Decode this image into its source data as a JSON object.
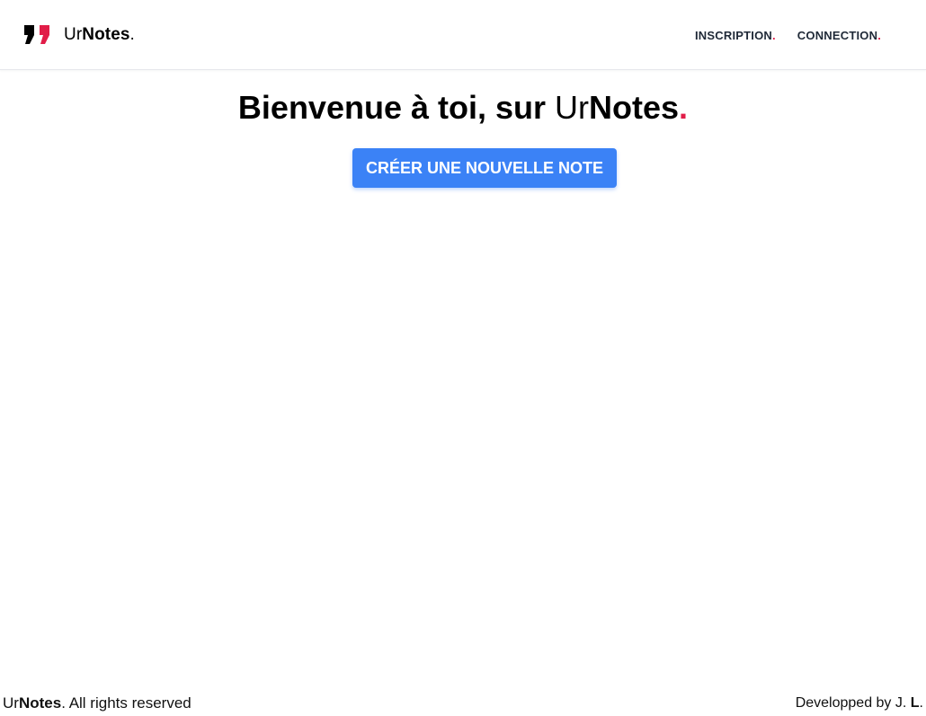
{
  "navbar": {
    "brand": {
      "prefix": "Ur",
      "name_bold": "Notes",
      "dot": ".",
      "icon": "quote-icon"
    },
    "links": [
      {
        "label": "INSCRIPTION",
        "dot": "."
      },
      {
        "label": "CONNECTION",
        "dot": "."
      }
    ]
  },
  "hero": {
    "title_prefix": "Bienvenue à toi, sur ",
    "title_brand_thin": "Ur",
    "title_brand_bold": "Notes",
    "title_dot": ".",
    "cta_label": "CRÉER UNE NOUVELLE NOTE"
  },
  "footer": {
    "left_prefix": "Ur",
    "left_bold": "Notes",
    "left_suffix": ". All rights reserved",
    "right_prefix": "Developped by J. ",
    "right_bold": "L",
    "right_suffix": "."
  },
  "colors": {
    "accent_red": "#e11d48",
    "primary_blue": "#3b82f6"
  }
}
